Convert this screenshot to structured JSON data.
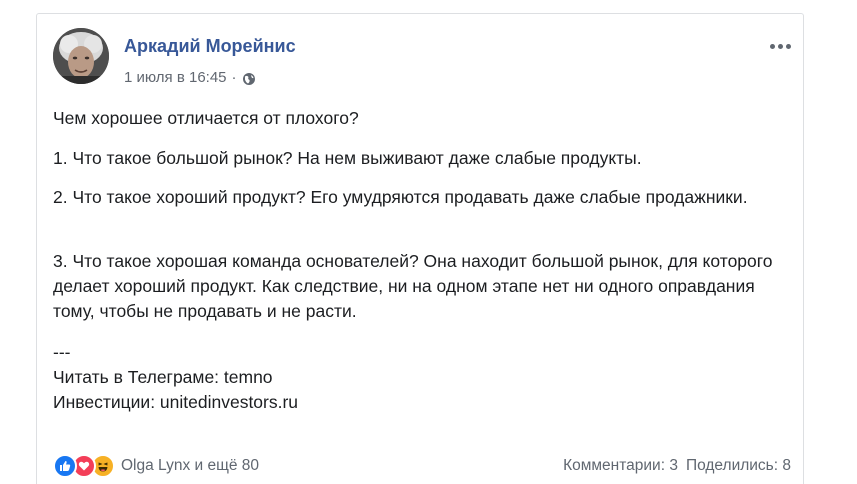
{
  "post": {
    "author": "Аркадий Морейнис",
    "date": "1 июля в 16:45",
    "separator": "·",
    "paragraphs": {
      "p1": "Чем хорошее отличается от плохого?",
      "p2": "1. Что такое большой рынок? На нем выживают даже слабые продукты.",
      "p3": "2. Что такое хороший продукт? Его умудряются продавать даже слабые продажники.",
      "p4": "3. Что такое хорошая команда основателей? Она находит большой рынок, для которого делает хороший продукт. Как следствие, ни на одном этапе нет ни одного оправдания тому, чтобы не продавать и не расти.",
      "p5_line1": "---",
      "p5_line2": "Читать в Телеграме: temno",
      "p5_line3": "Инвестиции: unitedinvestors.ru"
    },
    "icons": {
      "privacy": "globe-icon",
      "menu": "more-horizontal-icon",
      "reactions": [
        "like-icon",
        "love-icon",
        "haha-icon"
      ]
    }
  },
  "footer": {
    "reactions_label": "Olga Lynx и ещё 80",
    "comments": "Комментарии: 3",
    "shares": "Поделились: 8"
  },
  "colors": {
    "author_link": "#385898",
    "meta_text": "#616770",
    "body_text": "#1c1e21",
    "like": "#1877f2",
    "love": "#f33e58",
    "haha": "#f7b125"
  }
}
